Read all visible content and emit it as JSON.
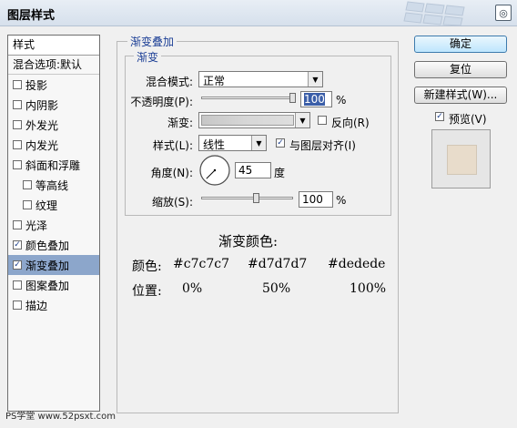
{
  "window": {
    "title": "图层样式",
    "close_glyph": "◎"
  },
  "left_panel": {
    "header": "样式",
    "blend_options": "混合选项:默认",
    "items": [
      {
        "label": "投影",
        "checked": false
      },
      {
        "label": "内阴影",
        "checked": false
      },
      {
        "label": "外发光",
        "checked": false
      },
      {
        "label": "内发光",
        "checked": false
      },
      {
        "label": "斜面和浮雕",
        "checked": false
      },
      {
        "label": "等高线",
        "checked": false
      },
      {
        "label": "纹理",
        "checked": false
      },
      {
        "label": "光泽",
        "checked": false
      },
      {
        "label": "颜色叠加",
        "checked": true
      },
      {
        "label": "渐变叠加",
        "checked": true,
        "selected": true
      },
      {
        "label": "图案叠加",
        "checked": false
      },
      {
        "label": "描边",
        "checked": false
      }
    ]
  },
  "panel": {
    "group_title": "渐变叠加",
    "subgroup_title": "渐变",
    "blend_mode": {
      "label": "混合模式:",
      "value": "正常"
    },
    "opacity": {
      "label": "不透明度(P):",
      "value": "100",
      "unit": "%",
      "level": 100
    },
    "gradient": {
      "label": "渐变:",
      "reverse_label": "反向(R)",
      "reverse_checked": false,
      "stops": [
        "#c7c7c7",
        "#d7d7d7",
        "#dedede"
      ]
    },
    "style": {
      "label": "样式(L):",
      "value": "线性",
      "align_label": "与图层对齐(I)",
      "align_checked": true
    },
    "angle": {
      "label": "角度(N):",
      "value": "45",
      "unit": "度",
      "degrees": 45
    },
    "scale": {
      "label": "缩放(S):",
      "value": "100",
      "unit": "%",
      "level": 100
    }
  },
  "info": {
    "title": "渐变颜色:",
    "color_label": "颜色:",
    "colors": [
      "#c7c7c7",
      "#d7d7d7",
      "#dedede"
    ],
    "position_label": "位置:",
    "positions": [
      "0%",
      "50%",
      "100%"
    ]
  },
  "buttons": {
    "ok": "确定",
    "reset": "复位",
    "new_style": "新建样式(W)...",
    "preview_label": "预览(V)",
    "preview_checked": true
  },
  "preview": {
    "fill": "#e8dccb",
    "border": "#d2c7b6"
  },
  "watermark": "PS学堂 www.52psxt.com",
  "check_glyph": "✓"
}
